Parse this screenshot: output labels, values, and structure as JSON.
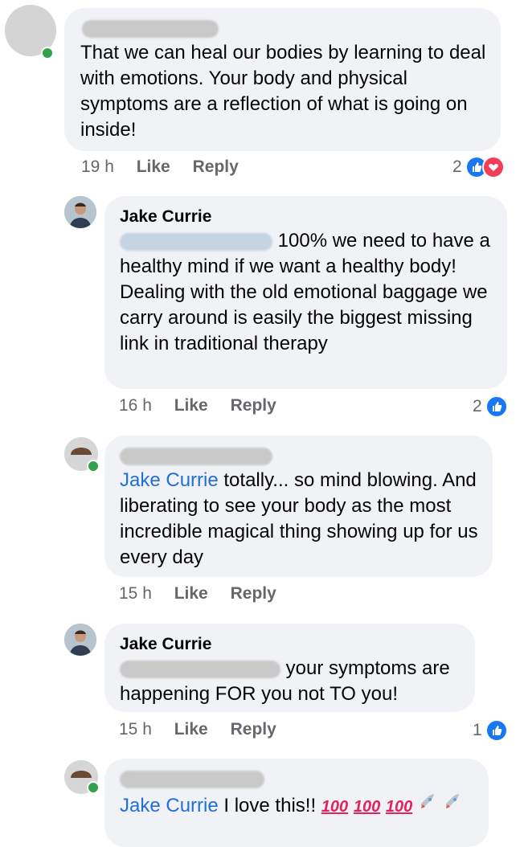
{
  "comments": [
    {
      "author": "",
      "text": "That we can heal our bodies by learning to deal with emotions. Your body and physical symptoms are a reflection of what is going on inside!",
      "time": "19 h",
      "like": "Like",
      "reply": "Reply",
      "reactions": "2"
    },
    {
      "author": "Jake Currie",
      "text": "100% we need to have a healthy mind if we want a healthy body! Dealing with the old emotional baggage we carry around is easily the biggest missing link in traditional therapy",
      "time": "16 h",
      "like": "Like",
      "reply": "Reply",
      "reactions": "2"
    },
    {
      "author": "",
      "mention": "Jake Currie",
      "text": "totally... so mind blowing. And liberating to see your body as the most incredible magical thing showing up for us every day",
      "time": "15 h",
      "like": "Like",
      "reply": "Reply"
    },
    {
      "author": "Jake Currie",
      "text": "your symptoms are happening FOR you not TO you!",
      "time": "15 h",
      "like": "Like",
      "reply": "Reply",
      "reactions": "1"
    },
    {
      "author": "",
      "mention": "Jake Currie",
      "text": "I love this!!"
    }
  ],
  "colors": {
    "link": "#216fdb",
    "bubble": "#f0f2f5",
    "like": "#1877f2",
    "love": "#f33e58",
    "online": "#31a24c"
  },
  "icons": [
    "like-icon",
    "love-icon",
    "hundred-points-emoji",
    "rocket-emoji"
  ]
}
